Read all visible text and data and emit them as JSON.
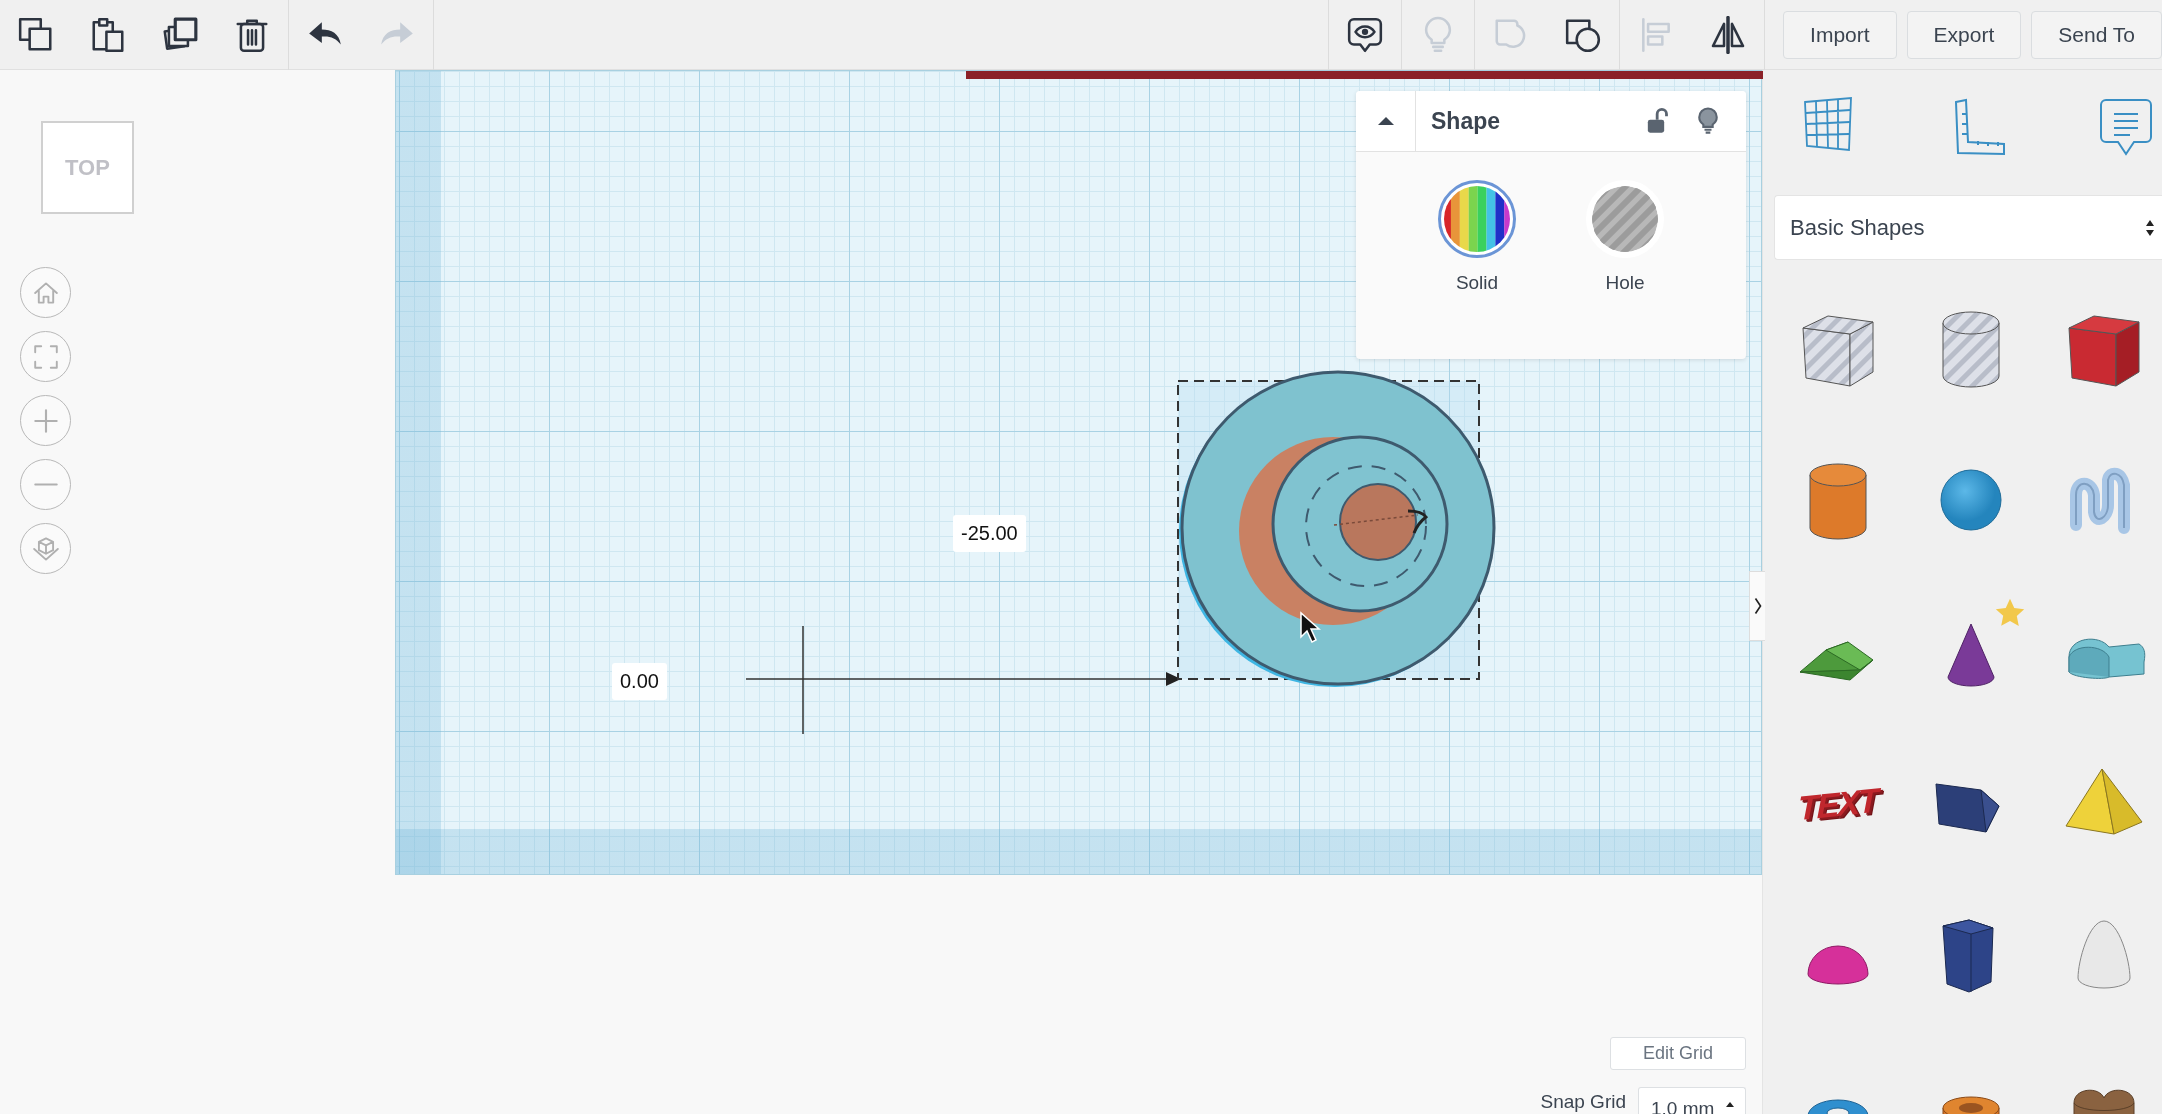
{
  "toolbar": {
    "left_tools": [
      {
        "kind": "copy",
        "disabled": false
      },
      {
        "kind": "paste",
        "disabled": false
      },
      {
        "kind": "duplicate",
        "disabled": false
      },
      {
        "kind": "delete",
        "disabled": false
      },
      {
        "kind": "undo",
        "disabled": false
      },
      {
        "kind": "redo",
        "disabled": true
      }
    ],
    "right_tools": [
      {
        "kind": "notes",
        "disabled": false
      },
      {
        "kind": "hint",
        "disabled": true
      },
      {
        "kind": "group",
        "disabled": true
      },
      {
        "kind": "combine",
        "disabled": false
      },
      {
        "kind": "align",
        "disabled": true
      },
      {
        "kind": "mirror",
        "disabled": false
      }
    ],
    "buttons": [
      "Import",
      "Export",
      "Send To"
    ]
  },
  "view_cube": {
    "label": "TOP"
  },
  "nav_buttons": [
    {
      "kind": "home"
    },
    {
      "kind": "fit"
    },
    {
      "kind": "zoom_in"
    },
    {
      "kind": "zoom_out"
    },
    {
      "kind": "perspective"
    }
  ],
  "workplane": {
    "dimension_labels": [
      {
        "kind": "x",
        "value": "-25.00"
      },
      {
        "kind": "y",
        "value": "0.00"
      }
    ]
  },
  "shape_panel": {
    "title": "Shape",
    "locked": false,
    "options": [
      {
        "kind": "solid",
        "label": "Solid",
        "selected": true
      },
      {
        "kind": "hole",
        "label": "Hole",
        "selected": false
      }
    ]
  },
  "sidebar": {
    "tools": [
      {
        "kind": "workplane"
      },
      {
        "kind": "ruler"
      },
      {
        "kind": "notes"
      }
    ],
    "category": "Basic Shapes",
    "shapes": [
      {
        "kind": "box_hole",
        "featured": false
      },
      {
        "kind": "cylinder_hole",
        "featured": false
      },
      {
        "kind": "box",
        "featured": false
      },
      {
        "kind": "cylinder",
        "featured": false
      },
      {
        "kind": "sphere",
        "featured": false
      },
      {
        "kind": "scribble",
        "featured": false
      },
      {
        "kind": "roof",
        "featured": false
      },
      {
        "kind": "cone",
        "featured": true
      },
      {
        "kind": "round_roof",
        "featured": false
      },
      {
        "kind": "text",
        "label": "TEXT",
        "featured": false
      },
      {
        "kind": "prism",
        "featured": false
      },
      {
        "kind": "pyramid",
        "featured": false
      },
      {
        "kind": "half_sphere",
        "featured": false
      },
      {
        "kind": "polygon",
        "featured": false
      },
      {
        "kind": "paraboloid",
        "featured": false
      },
      {
        "kind": "torus",
        "featured": false
      },
      {
        "kind": "tube",
        "featured": false
      },
      {
        "kind": "heart",
        "featured": false
      }
    ]
  },
  "grid_controls": {
    "edit_button": "Edit Grid",
    "snap_label": "Snap Grid",
    "snap_value": "1.0 mm"
  }
}
